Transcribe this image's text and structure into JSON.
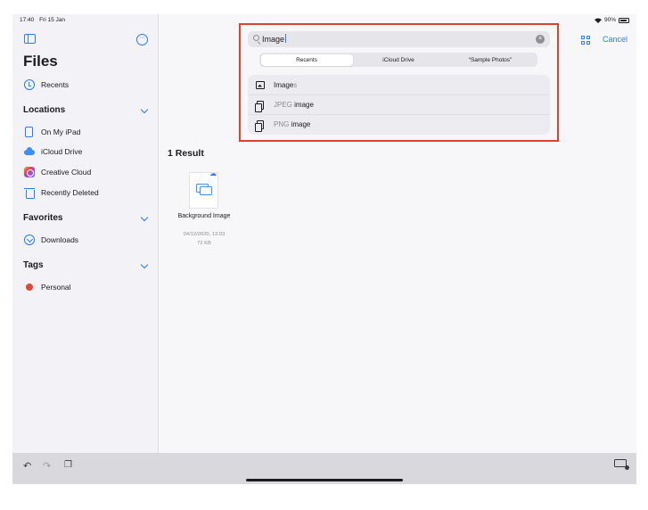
{
  "status": {
    "time": "17:40",
    "date": "Fri 15 Jan",
    "battery": "90%"
  },
  "sidebar": {
    "title": "Files",
    "recents": "Recents",
    "locations_header": "Locations",
    "locations": [
      "On My iPad",
      "iCloud Drive",
      "Creative Cloud",
      "Recently Deleted"
    ],
    "favorites_header": "Favorites",
    "favorites": [
      "Downloads"
    ],
    "tags_header": "Tags",
    "tags": [
      {
        "label": "Personal",
        "color": "#e0483c"
      }
    ]
  },
  "search": {
    "query": "Image",
    "cancel_label": "Cancel",
    "scopes": [
      "Recents",
      "iCloud Drive",
      "“Sample Photos”"
    ],
    "active_scope": "Recents",
    "suggestions": [
      {
        "icon": "image-icon",
        "prefix": "Image",
        "suffix": "s"
      },
      {
        "icon": "document-icon",
        "prefix": "JPEG",
        "suffix": " image"
      },
      {
        "icon": "document-icon",
        "prefix": "PNG",
        "suffix": " image"
      }
    ]
  },
  "results": {
    "heading": "1 Result",
    "file": {
      "name": "Background Image",
      "date": "04/12/2020, 12:03",
      "size": "72 KB"
    }
  },
  "colors": {
    "accent": "#2a7bf6",
    "highlight_box": "#d9452c"
  }
}
